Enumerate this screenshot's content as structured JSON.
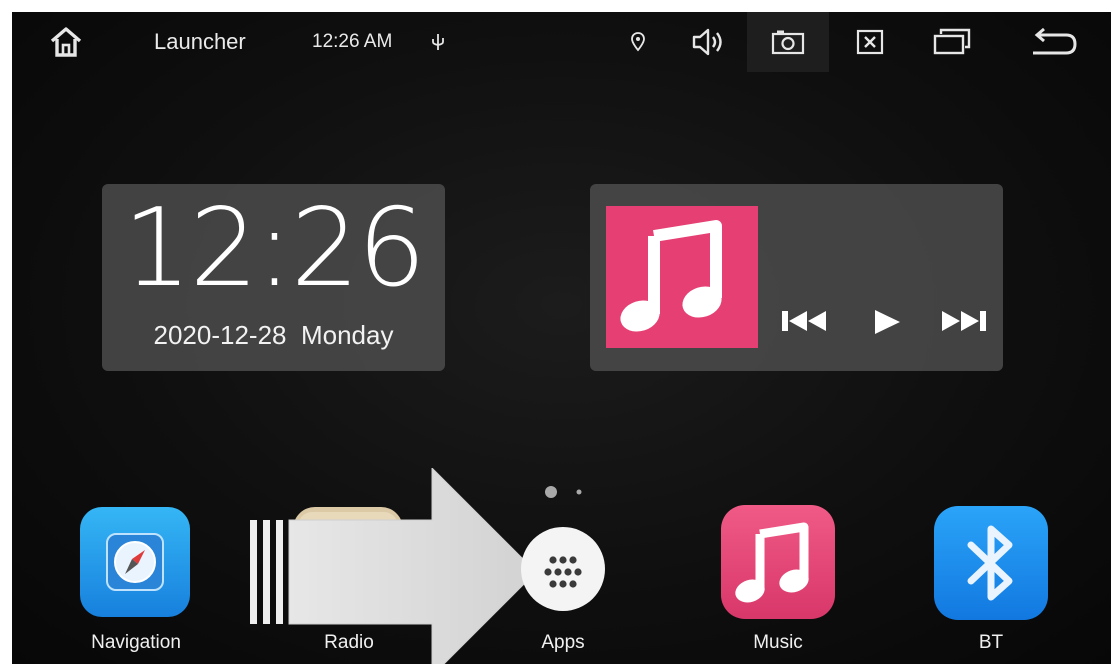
{
  "statusbar": {
    "title": "Launcher",
    "time": "12:26 AM"
  },
  "clock": {
    "time": "12:26",
    "date": "2020-12-28",
    "weekday": "Monday"
  },
  "dock": {
    "items": [
      {
        "label": "Navigation",
        "icon": "navigation-compass-icon"
      },
      {
        "label": "Radio",
        "icon": "radio-icon"
      },
      {
        "label": "Apps",
        "icon": "apps-grid-icon"
      },
      {
        "label": "Music",
        "icon": "music-note-icon"
      },
      {
        "label": "BT",
        "icon": "bluetooth-icon"
      }
    ]
  },
  "colors": {
    "music_pink": "#e63f73",
    "bt_blue": "#1e8ef0",
    "nav_blue": "#1f9bea"
  }
}
